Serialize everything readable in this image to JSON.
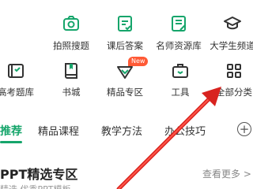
{
  "grid": {
    "row1": [
      {
        "label": "拍照搜题",
        "icon": "camera-icon"
      },
      {
        "label": "课后答案",
        "icon": "answer-book-icon"
      },
      {
        "label": "名师资源库",
        "icon": "teacher-resource-icon"
      },
      {
        "label": "大学生频道",
        "icon": "graduation-cap-icon"
      }
    ],
    "row2": [
      {
        "label": "高考题库",
        "icon": "exam-bank-icon"
      },
      {
        "label": "书城",
        "icon": "bookstore-icon"
      },
      {
        "label": "精品专区",
        "icon": "premium-zone-icon",
        "badge": "New"
      },
      {
        "label": "工具",
        "icon": "toolbox-icon"
      },
      {
        "label": "全部分类",
        "icon": "all-categories-icon"
      }
    ]
  },
  "tabs": [
    "推荐",
    "精品课程",
    "教学方法",
    "办公技巧"
  ],
  "tab_more_symbol": "+",
  "section": {
    "title": "PPT精选专区",
    "view_more": "查看更多 >",
    "subtitle": "精选 优秀PPT模板"
  },
  "colors": {
    "accent": "#16a56b",
    "arrow": "#d8231f",
    "badge": "#ff5a36"
  }
}
